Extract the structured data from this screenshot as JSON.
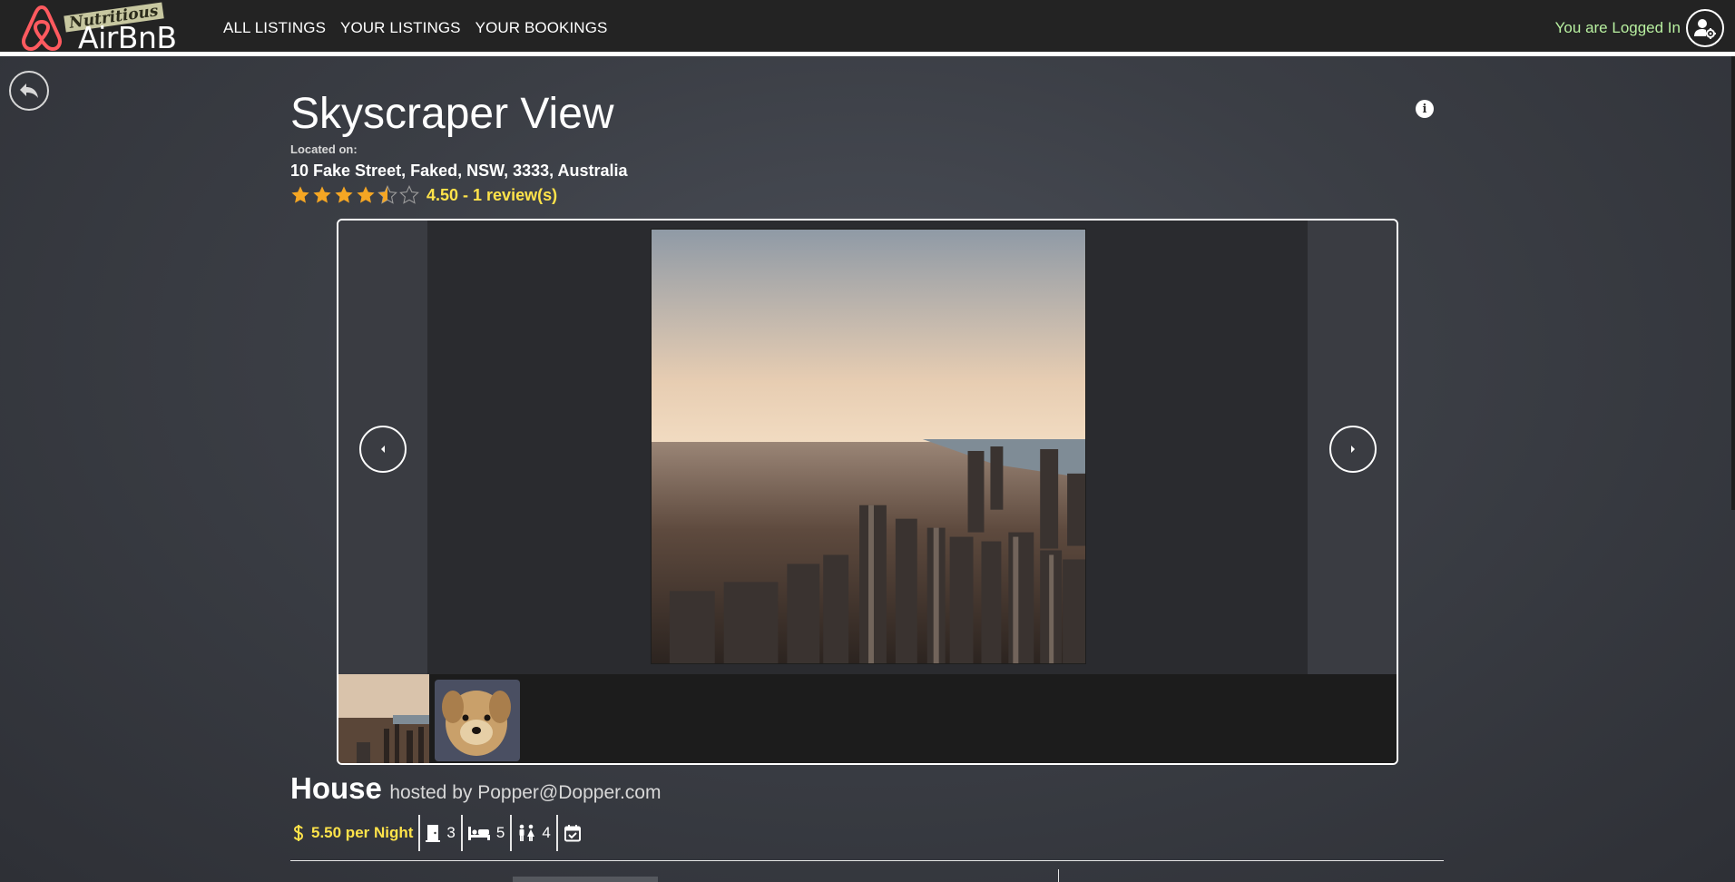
{
  "app": {
    "logo_text": "AirBnB",
    "logo_tagline": "Nutritious"
  },
  "nav": {
    "links": [
      {
        "label": "ALL LISTINGS"
      },
      {
        "label": "YOUR LISTINGS"
      },
      {
        "label": "YOUR BOOKINGS"
      }
    ],
    "login_status": "You are Logged In",
    "account_icon": "user-gear-icon"
  },
  "listing": {
    "title": "Skyscraper View",
    "located_label": "Located on:",
    "address": "10 Fake Street, Faked, NSW, 3333, Australia",
    "rating_value": 4.5,
    "rating_max": 5,
    "rating_text": "4.50 - 1 review(s)",
    "property_type": "House",
    "hosted_by": "hosted by Popper@Dopper.com",
    "price_text": "5.50 per Night",
    "bedrooms": "3",
    "beds": "5",
    "bathrooms": "4"
  },
  "gallery": {
    "current_index": 1,
    "thumbnails": [
      {
        "name": "city-skyline-thumbnail",
        "selected": true
      },
      {
        "name": "dog-thumbnail",
        "selected": false
      }
    ]
  },
  "colors": {
    "accent_yellow": "#ffe34a",
    "login_green": "#b8f0a0",
    "navbar_bg": "#232323",
    "logo_red": "#ff5a5f"
  }
}
